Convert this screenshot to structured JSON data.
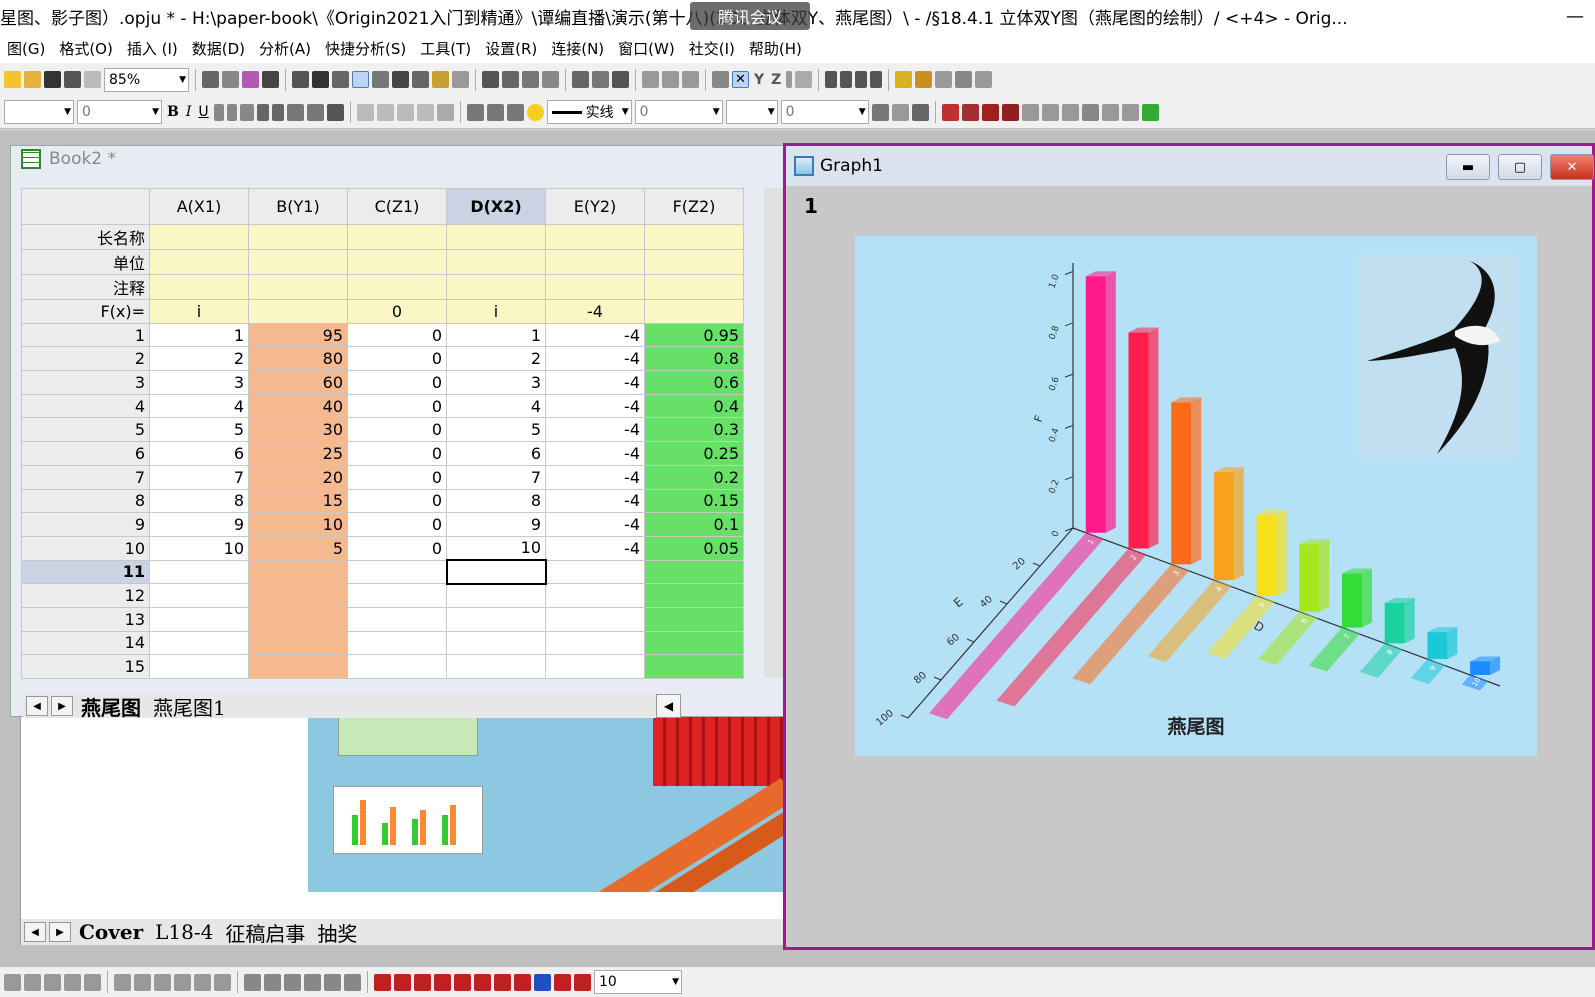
{
  "window_title": "星图、影子图）.opju * - H:\\paper-book\\《Origin2021入门到精通》\\谭编直播\\演示(第十八)(2D、立体双Y、燕尾图）\\ - /§18.4.1  立体双Y图（燕尾图的绘制）/ <+4> - Orig...",
  "overlay_text": "腾讯会议",
  "menu": [
    "图(G)",
    "格式(O)",
    "插入 (I)",
    "数据(D)",
    "分析(A)",
    "快捷分析(S)",
    "工具(T)",
    "设置(R)",
    "连接(N)",
    "窗口(W)",
    "社交(I)",
    "帮助(H)"
  ],
  "toolbar": {
    "zoom": "85%",
    "font_size": "0",
    "line_style": "实线",
    "line_width": "0",
    "pattern_value": "0",
    "status_value": "10"
  },
  "workbook": {
    "title": "Book2 *",
    "columns": [
      "A(X1)",
      "B(Y1)",
      "C(Z1)",
      "D(X2)",
      "E(Y2)",
      "F(Z2)"
    ],
    "meta_rows": [
      {
        "label": "长名称",
        "cells": [
          "",
          "",
          "",
          "",
          "",
          ""
        ]
      },
      {
        "label": "单位",
        "cells": [
          "",
          "",
          "",
          "",
          "",
          ""
        ]
      },
      {
        "label": "注释",
        "cells": [
          "",
          "",
          "",
          "",
          "",
          ""
        ]
      },
      {
        "label": "F(x)=",
        "cells": [
          "i",
          "",
          "0",
          "i",
          "-4",
          ""
        ]
      }
    ],
    "rows": [
      [
        "1",
        "1",
        "95",
        "0",
        "1",
        "-4",
        "0.95"
      ],
      [
        "2",
        "2",
        "80",
        "0",
        "2",
        "-4",
        "0.8"
      ],
      [
        "3",
        "3",
        "60",
        "0",
        "3",
        "-4",
        "0.6"
      ],
      [
        "4",
        "4",
        "40",
        "0",
        "4",
        "-4",
        "0.4"
      ],
      [
        "5",
        "5",
        "30",
        "0",
        "5",
        "-4",
        "0.3"
      ],
      [
        "6",
        "6",
        "25",
        "0",
        "6",
        "-4",
        "0.25"
      ],
      [
        "7",
        "7",
        "20",
        "0",
        "7",
        "-4",
        "0.2"
      ],
      [
        "8",
        "8",
        "15",
        "0",
        "8",
        "-4",
        "0.15"
      ],
      [
        "9",
        "9",
        "10",
        "0",
        "9",
        "-4",
        "0.1"
      ],
      [
        "10",
        "10",
        "5",
        "0",
        "10",
        "-4",
        "0.05"
      ],
      [
        "11",
        "",
        "",
        "",
        "",
        "",
        ""
      ],
      [
        "12",
        "",
        "",
        "",
        "",
        "",
        ""
      ],
      [
        "13",
        "",
        "",
        "",
        "",
        "",
        ""
      ],
      [
        "14",
        "",
        "",
        "",
        "",
        "",
        ""
      ],
      [
        "15",
        "",
        "",
        "",
        "",
        "",
        ""
      ]
    ],
    "sheet_tabs": [
      "燕尾图",
      "燕尾图1"
    ]
  },
  "cover": {
    "sheet_tabs": [
      "Cover",
      "L18-4",
      "征稿启事",
      "抽奖"
    ]
  },
  "graph": {
    "title": "Graph1",
    "layer_number": "1",
    "plot_title": "燕尾图",
    "z_ticks": [
      "1.0",
      "0.8",
      "0.6",
      "0.4",
      "0.2",
      "0"
    ],
    "e_ticks": [
      "20",
      "40",
      "60",
      "80",
      "100"
    ],
    "x_ticks": [
      "1",
      "2",
      "3",
      "4",
      "5",
      "6",
      "7",
      "8",
      "9",
      "10"
    ],
    "axis_labels": {
      "z": "F",
      "y": "E",
      "x": "D"
    }
  },
  "chart_data": {
    "type": "bar",
    "categories": [
      "1",
      "2",
      "3",
      "4",
      "5",
      "6",
      "7",
      "8",
      "9",
      "10"
    ],
    "series": [
      {
        "values": [
          0.95,
          0.8,
          0.6,
          0.4,
          0.3,
          0.25,
          0.2,
          0.15,
          0.1,
          0.05
        ]
      },
      {
        "values": [
          95,
          80,
          60,
          40,
          30,
          25,
          20,
          15,
          10,
          5
        ]
      }
    ],
    "colors": [
      "#ff1a8c",
      "#ff1f4b",
      "#ff6a1a",
      "#f7a21a",
      "#f5e01a",
      "#a6e61a",
      "#33dd33",
      "#1ad1a0",
      "#1ac8d8",
      "#1a8cff"
    ],
    "title": "燕尾图"
  }
}
